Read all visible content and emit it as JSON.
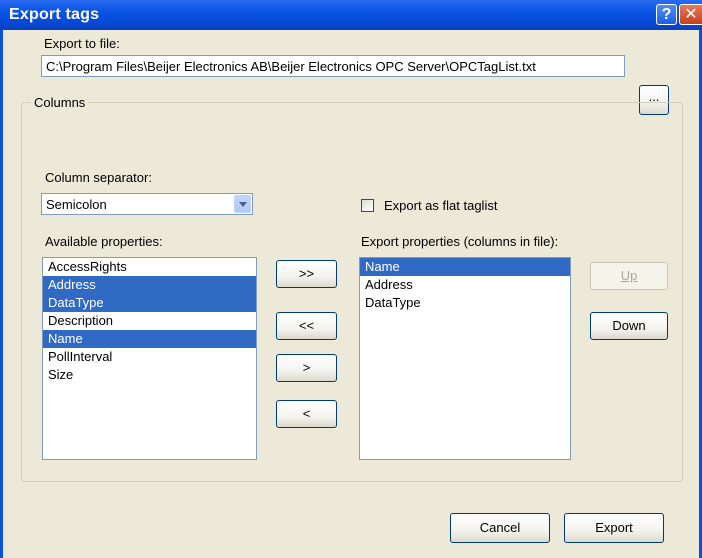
{
  "window": {
    "title": "Export tags",
    "help_glyph": "?",
    "close_glyph": "✕"
  },
  "export_file": {
    "label": "Export to file:",
    "value": "C:\\Program Files\\Beijer Electronics AB\\Beijer Electronics OPC Server\\OPCTagList.txt",
    "browse_label": "..."
  },
  "columns": {
    "group_label": "Columns",
    "separator_label": "Column separator:",
    "separator_value": "Semicolon",
    "flat_taglist_label": "Export as flat taglist",
    "flat_taglist_checked": false,
    "available_label": "Available properties:",
    "available_items": [
      {
        "label": "AccessRights",
        "selected": false
      },
      {
        "label": "Address",
        "selected": true
      },
      {
        "label": "DataType",
        "selected": true
      },
      {
        "label": "Description",
        "selected": false
      },
      {
        "label": "Name",
        "selected": true
      },
      {
        "label": "PollInterval",
        "selected": false
      },
      {
        "label": "Size",
        "selected": false
      }
    ],
    "export_label": "Export properties (columns in file):",
    "export_items": [
      {
        "label": "Name",
        "selected": true
      },
      {
        "label": "Address",
        "selected": false
      },
      {
        "label": "DataType",
        "selected": false
      }
    ],
    "move_all_right": ">>",
    "move_all_left": "<<",
    "move_right": ">",
    "move_left": "<",
    "up_label": "Up",
    "down_label": "Down"
  },
  "footer": {
    "cancel_label": "Cancel",
    "export_label": "Export"
  },
  "colors": {
    "title_bar": "#0a52d6",
    "dialog_bg": "#ece9d8",
    "selection": "#316ac5"
  }
}
